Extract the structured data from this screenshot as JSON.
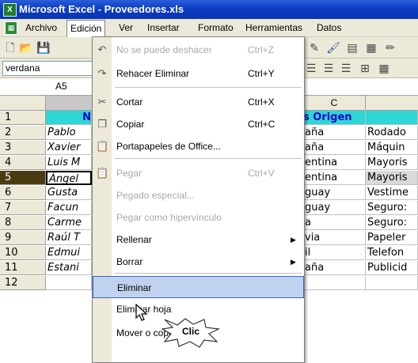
{
  "window": {
    "title": "Microsoft Excel - Proveedores.xls"
  },
  "menubar": {
    "items": [
      "Archivo",
      "Edición",
      "Ver",
      "Insertar",
      "Formato",
      "Herramientas",
      "Datos"
    ]
  },
  "format": {
    "font": "verdana"
  },
  "formula": {
    "name_box": "A5"
  },
  "grid": {
    "col_c_header": "C",
    "row_numbers": [
      "1",
      "2",
      "3",
      "4",
      "5",
      "6",
      "7",
      "8",
      "9",
      "10",
      "11",
      "12"
    ],
    "col_a_visible": [
      "N",
      "Pablo",
      "Xavier",
      "Luis M",
      "Ángel",
      "Gusta",
      "Facun",
      "Carme",
      "Raúl T",
      "Edmui",
      "Estani",
      ""
    ],
    "col_c_visible": [
      "s Origen",
      "aña",
      "aña",
      "entina",
      "entina",
      "guay",
      "guay",
      "a",
      "via",
      "il",
      "aña",
      ""
    ],
    "col_d_visible": [
      "",
      "Rodado",
      "Máquin",
      "Mayoris",
      "Mayoris",
      "Vestime",
      "Seguro:",
      "Seguro:",
      "Papeler",
      "Telefon",
      "Publicid",
      ""
    ]
  },
  "edit_menu": {
    "items": [
      {
        "label": "No se puede deshacer",
        "shortcut": "Ctrl+Z",
        "icon": "undo-icon",
        "enabled": false
      },
      {
        "label": "Rehacer Eliminar",
        "shortcut": "Ctrl+Y",
        "icon": "redo-icon",
        "enabled": true
      },
      {
        "label": "Cortar",
        "shortcut": "Ctrl+X",
        "icon": "scissors-icon",
        "enabled": true
      },
      {
        "label": "Copiar",
        "shortcut": "Ctrl+C",
        "icon": "copy-icon",
        "enabled": true
      },
      {
        "label": "Portapapeles de Office...",
        "shortcut": "",
        "icon": "clipboard-icon",
        "enabled": true
      },
      {
        "label": "Pegar",
        "shortcut": "Ctrl+V",
        "icon": "paste-icon",
        "enabled": false
      },
      {
        "label": "Pegado especial...",
        "shortcut": "",
        "icon": "",
        "enabled": false
      },
      {
        "label": "Pegar como hipervínculo",
        "shortcut": "",
        "icon": "",
        "enabled": false
      },
      {
        "label": "Rellenar",
        "shortcut": "",
        "icon": "",
        "enabled": true,
        "submenu": true
      },
      {
        "label": "Borrar",
        "shortcut": "",
        "icon": "",
        "enabled": true,
        "submenu": true
      },
      {
        "label": "Eliminar",
        "shortcut": "",
        "icon": "",
        "enabled": true,
        "highlighted": true
      },
      {
        "label": "Eliminar hoja",
        "shortcut": "",
        "icon": "",
        "enabled": true
      },
      {
        "label": "Mover o copiar hoja...",
        "shortcut": "",
        "icon": "",
        "enabled": true
      }
    ]
  },
  "callout": {
    "text": "Clic"
  },
  "colors": {
    "title_bar": "#0a36b0",
    "header_fill": "#2ed6d6",
    "header_text": "#1f00c8",
    "highlight": "#c1d2ee"
  }
}
